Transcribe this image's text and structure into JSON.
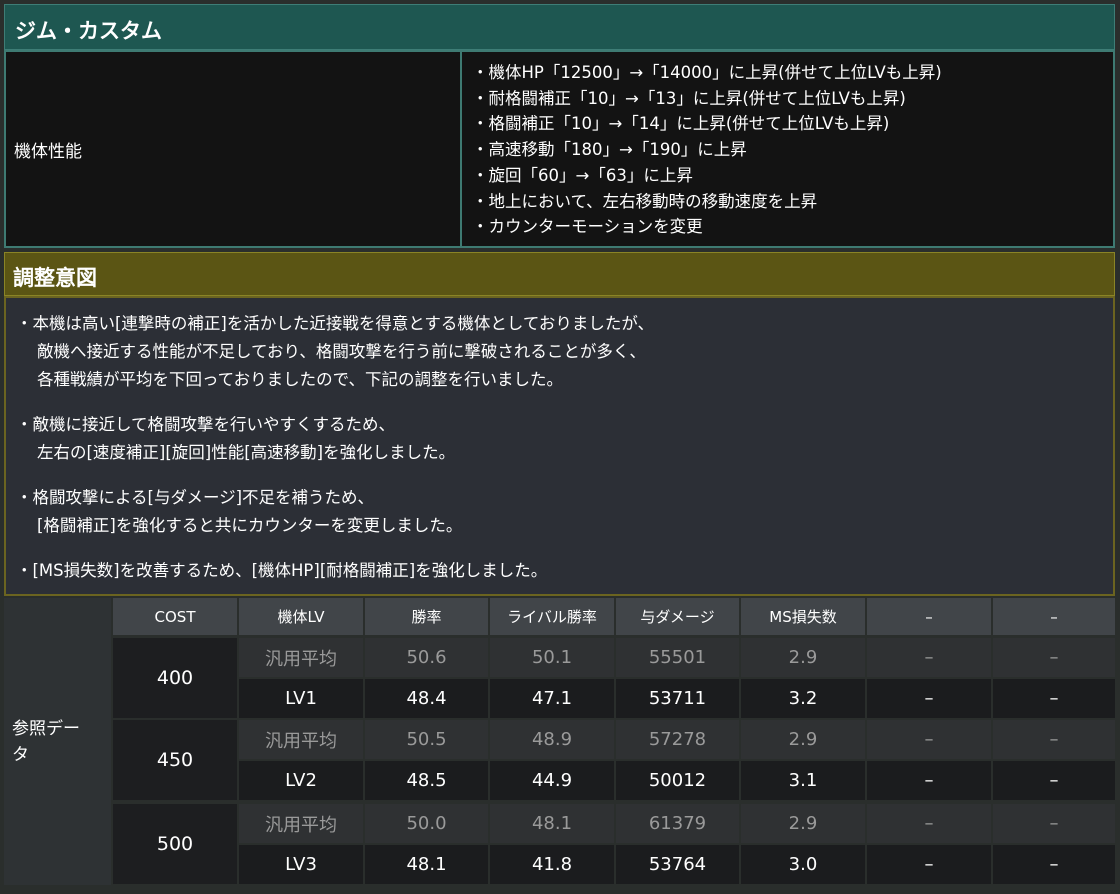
{
  "title": "ジム・カスタム",
  "performance": {
    "label": "機体性能",
    "items": [
      "・機体HP「12500」→「14000」に上昇(併せて上位LVも上昇)",
      "・耐格闘補正「10」→「13」に上昇(併せて上位LVも上昇)",
      "・格闘補正「10」→「14」に上昇(併せて上位LVも上昇)",
      "・高速移動「180」→「190」に上昇",
      "・旋回「60」→「63」に上昇",
      "・地上において、左右移動時の移動速度を上昇",
      "・カウンターモーションを変更"
    ]
  },
  "intent": {
    "title": "調整意図",
    "paragraphs": [
      [
        "・本機は高い[連撃時の補正]を活かした近接戦を得意とする機体としておりましたが、",
        "敵機へ接近する性能が不足しており、格闘攻撃を行う前に撃破されることが多く、",
        "各種戦績が平均を下回っておりましたので、下記の調整を行いました。"
      ],
      [
        "・敵機に接近して格闘攻撃を行いやすくするため、",
        "左右の[速度補正][旋回]性能[高速移動]を強化しました。"
      ],
      [
        "・格闘攻撃による[与ダメージ]不足を補うため、",
        "[格闘補正]を強化すると共にカウンターを変更しました。"
      ],
      [
        "・[MS損失数]を改善するため、[機体HP][耐格闘補正]を強化しました。"
      ]
    ]
  },
  "reference": {
    "label_line1": "参照デー",
    "label_line2": "タ",
    "headers": [
      "COST",
      "機体LV",
      "勝率",
      "ライバル勝率",
      "与ダメージ",
      "MS損失数",
      "–",
      "–"
    ],
    "groups": [
      {
        "cost": "400",
        "rows": [
          [
            "汎用平均",
            "50.6",
            "50.1",
            "55501",
            "2.9",
            "–",
            "–"
          ],
          [
            "LV1",
            "48.4",
            "47.1",
            "53711",
            "3.2",
            "–",
            "–"
          ]
        ]
      },
      {
        "cost": "450",
        "rows": [
          [
            "汎用平均",
            "50.5",
            "48.9",
            "57278",
            "2.9",
            "–",
            "–"
          ],
          [
            "LV2",
            "48.5",
            "44.9",
            "50012",
            "3.1",
            "–",
            "–"
          ]
        ]
      },
      {
        "cost": "500",
        "rows": [
          [
            "汎用平均",
            "50.0",
            "48.1",
            "61379",
            "2.9",
            "–",
            "–"
          ],
          [
            "LV3",
            "48.1",
            "41.8",
            "53764",
            "3.0",
            "–",
            "–"
          ]
        ]
      }
    ]
  }
}
